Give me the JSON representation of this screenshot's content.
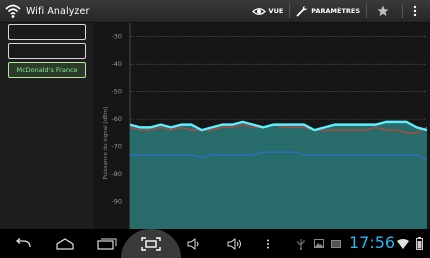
{
  "app": {
    "title": "Wifi Analyzer",
    "icon": "wifi-icon"
  },
  "actionbar": {
    "view_label": "VUE",
    "settings_label": "PARAMÈTRES",
    "favorite_icon": "star-icon",
    "overflow_icon": "overflow-menu-icon"
  },
  "ssid_list": [
    {
      "label": "",
      "selected": false
    },
    {
      "label": "",
      "selected": false
    },
    {
      "label": "McDonald's France",
      "selected": true
    }
  ],
  "chart_data": {
    "type": "line",
    "ylabel": "Puissance du signal [dBm]",
    "ylim": [
      -100,
      -25
    ],
    "yticks": [
      -30,
      -40,
      -50,
      -60,
      -70,
      -80,
      -90
    ],
    "grid": true,
    "series": [
      {
        "color": "#5ef0ff",
        "highlighted": true,
        "values": [
          -62,
          -63,
          -63,
          -62,
          -63,
          -62,
          -62,
          -64,
          -63,
          -62,
          -62,
          -61,
          -62,
          -63,
          -62,
          -62,
          -62,
          -62,
          -64,
          -63,
          -62,
          -62,
          -62,
          -62,
          -62,
          -61,
          -61,
          -61,
          -63,
          -64
        ]
      },
      {
        "color": "#c0443a",
        "highlighted": false,
        "values": [
          -63,
          -64,
          -64,
          -63,
          -64,
          -63,
          -64,
          -64,
          -64,
          -63,
          -63,
          -62,
          -63,
          -63,
          -62,
          -63,
          -63,
          -63,
          -64,
          -64,
          -64,
          -64,
          -64,
          -64,
          -63,
          -64,
          -64,
          -65,
          -65,
          -63
        ]
      },
      {
        "color": "#2f6ecf",
        "highlighted": false,
        "values": [
          -73,
          -73,
          -73,
          -73,
          -73,
          -73,
          -73,
          -74,
          -73,
          -73,
          -73,
          -73,
          -73,
          -72,
          -72,
          -72,
          -72,
          -73,
          -73,
          -73,
          -73,
          -73,
          -73,
          -73,
          -73,
          -73,
          -73,
          -73,
          -73,
          -75
        ]
      }
    ]
  },
  "navbar": {
    "back_icon": "back-icon",
    "home_icon": "home-icon",
    "recent_icon": "recent-apps-icon",
    "screenshot_icon": "screenshot-icon",
    "volume_down_icon": "volume-down-icon",
    "volume_up_icon": "volume-up-icon",
    "menu_icon": "menu-icon"
  },
  "status": {
    "time": "17:56",
    "clock_color": "#29b6f6"
  }
}
